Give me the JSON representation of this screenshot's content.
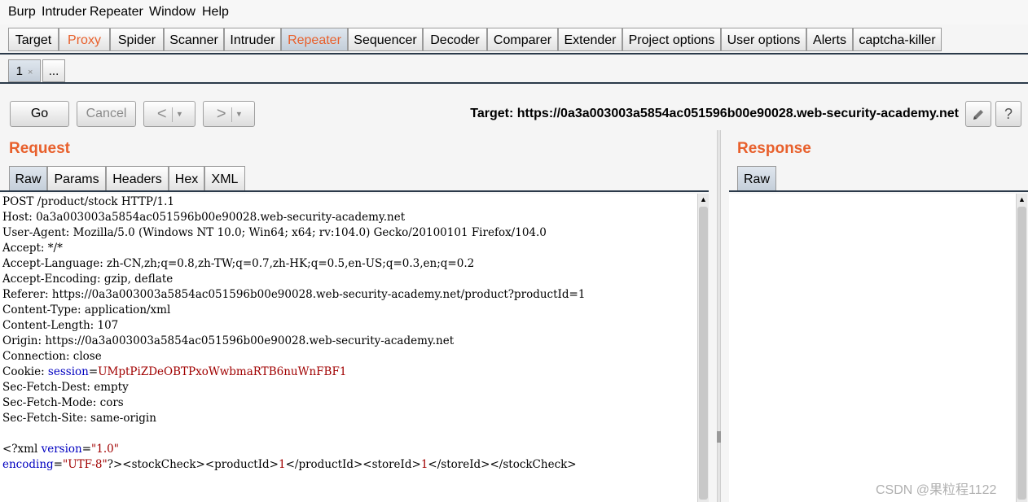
{
  "menu": [
    "Burp",
    "Intruder",
    "Repeater",
    "Window",
    "Help"
  ],
  "main_tabs": [
    {
      "label": "Target"
    },
    {
      "label": "Proxy"
    },
    {
      "label": "Spider"
    },
    {
      "label": "Scanner"
    },
    {
      "label": "Intruder"
    },
    {
      "label": "Repeater"
    },
    {
      "label": "Sequencer"
    },
    {
      "label": "Decoder"
    },
    {
      "label": "Comparer"
    },
    {
      "label": "Extender"
    },
    {
      "label": "Project options"
    },
    {
      "label": "User options"
    },
    {
      "label": "Alerts"
    },
    {
      "label": "captcha-killer"
    }
  ],
  "sub_tabs": {
    "first": "1",
    "close": "×",
    "more": "..."
  },
  "toolbar": {
    "go": "Go",
    "cancel": "Cancel",
    "back": "<",
    "forward": ">",
    "dropdown": "▾",
    "target_text": "Target: https://0a3a003003a5854ac051596b00e90028.web-security-academy.net",
    "edit_icon": "pencil-icon",
    "help_icon": "?"
  },
  "request": {
    "title": "Request",
    "tabs": [
      "Raw",
      "Params",
      "Headers",
      "Hex",
      "XML"
    ],
    "lines": [
      "POST /product/stock HTTP/1.1",
      "Host: 0a3a003003a5854ac051596b00e90028.web-security-academy.net",
      "User-Agent: Mozilla/5.0 (Windows NT 10.0; Win64; x64; rv:104.0) Gecko/20100101 Firefox/104.0",
      "Accept: */*",
      "Accept-Language: zh-CN,zh;q=0.8,zh-TW;q=0.7,zh-HK;q=0.5,en-US;q=0.3,en;q=0.2",
      "Accept-Encoding: gzip, deflate",
      "Referer: https://0a3a003003a5854ac051596b00e90028.web-security-academy.net/product?productId=1",
      "Content-Type: application/xml",
      "Content-Length: 107",
      "Origin: https://0a3a003003a5854ac051596b00e90028.web-security-academy.net",
      "Connection: close"
    ],
    "cookie": {
      "prefix": "Cookie: ",
      "name": "session",
      "eq": "=",
      "value": "UMptPiZDeOBTPxoWwbmaRTB6nuWnFBF1"
    },
    "lines_after": [
      "Sec-Fetch-Dest: empty",
      "Sec-Fetch-Mode: cors",
      "Sec-Fetch-Site: same-origin"
    ],
    "xml": {
      "line1_prefix": "<?xml ",
      "version_attr": "version",
      "version_value": "\"1.0\"",
      "encoding_attr": "encoding",
      "encoding_value": "\"UTF-8\"",
      "rest_a": "?><stockCheck><productId>",
      "product_id": "1",
      "rest_b": "</productId><storeId>",
      "store_id": "1",
      "rest_c": "</storeId></stockCheck>"
    }
  },
  "response": {
    "title": "Response",
    "tabs": [
      "Raw"
    ]
  },
  "watermark": "CSDN @果粒程1122"
}
